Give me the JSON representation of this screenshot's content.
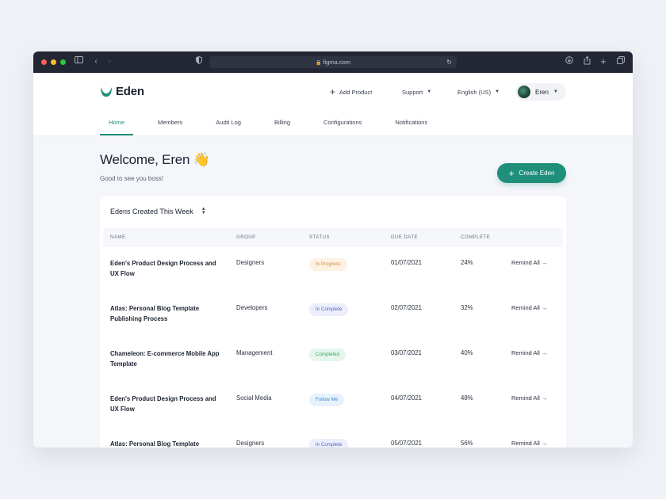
{
  "browser": {
    "url": "figma.com"
  },
  "header": {
    "brand": "Eden",
    "add_product": "Add Product",
    "support": "Support",
    "language": "English (US)",
    "user": "Eren"
  },
  "tabs": [
    "Home",
    "Members",
    "Audit Log",
    "Billing",
    "Configurations",
    "Notifications"
  ],
  "welcome": {
    "title": "Welcome, Eren 👋",
    "subtitle": "Good to see you boss!"
  },
  "create_button": "Create Eden",
  "table": {
    "title": "Edens Created This Week",
    "columns": [
      "NAME",
      "GROUP",
      "STATUS",
      "DUE DATE",
      "COMPLETE"
    ],
    "rows": [
      {
        "name": "Eden's Product Design Process and UX Flow",
        "group": "Designers",
        "status": "In Progress",
        "due": "01/07/2021",
        "complete": "24%",
        "action": "Remind All →"
      },
      {
        "name": "Atlas: Personal Blog Template Publishing Process",
        "group": "Developers",
        "status": "In Complete",
        "due": "02/07/2021",
        "complete": "32%",
        "action": "Remind All →"
      },
      {
        "name": "Chameleon: E-commerce Mobile App Template",
        "group": "Management",
        "status": "Completed",
        "due": "03/07/2021",
        "complete": "40%",
        "action": "Remind All →"
      },
      {
        "name": "Eden's Product Design Process and UX Flow",
        "group": "Social Media",
        "status": "Follow Me",
        "due": "04/07/2021",
        "complete": "48%",
        "action": "Remind All →"
      },
      {
        "name": "Atlas: Personal Blog Template",
        "group": "Designers",
        "status": "In Complete",
        "due": "05/07/2021",
        "complete": "56%",
        "action": "Remind All →"
      }
    ]
  },
  "colors": {
    "accent": "#1f8f7b",
    "in_progress_bg": "#fdf1e3",
    "in_progress_fg": "#e08a2e",
    "in_complete_bg": "#eceefb",
    "in_complete_fg": "#5b63c8",
    "completed_bg": "#e6f6ec",
    "completed_fg": "#3aa563",
    "follow_me_bg": "#e7f2fd",
    "follow_me_fg": "#3a8bd8"
  }
}
